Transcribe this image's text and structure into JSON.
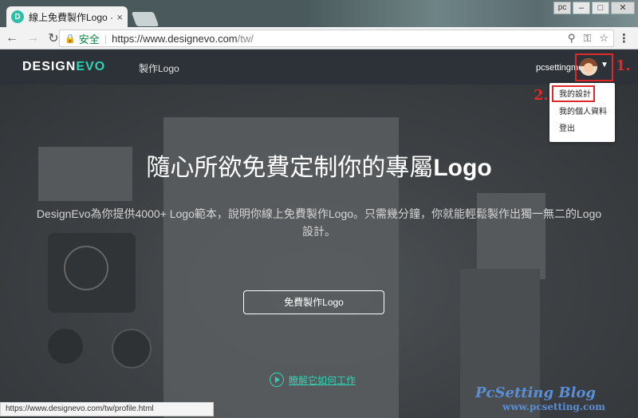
{
  "browser": {
    "tab_title": "線上免費製作Logo · 定制",
    "tab_favicon_letter": "D",
    "window_profile": "pc",
    "secure_label": "安全",
    "url_base": "https://www.designevo.com",
    "url_path": "/tw/",
    "status_url": "https://www.designevo.com/tw/profile.html"
  },
  "site": {
    "logo_main": "DESIGN",
    "logo_accent": "EVO",
    "nav_make_logo": "製作Logo",
    "username": "pcsettingme",
    "dropdown": [
      "我的設計",
      "我的個人資料",
      "登出"
    ]
  },
  "annotations": {
    "mark_1": "1.",
    "mark_2": "2."
  },
  "hero": {
    "title_prefix": "隨心所欲免費定制你的專屬",
    "title_bold": "Logo",
    "subtitle": "DesignEvo為你提供4000+ Logo範本，說明你線上免費製作Logo。只需幾分鐘，你就能輕鬆製作出獨一無二的Logo設計。",
    "cta": "免費製作Logo",
    "how_link": "瞭解它如何工作"
  },
  "watermark": {
    "line1": "PcSetting Blog",
    "line2": "www.pcsetting.com"
  }
}
